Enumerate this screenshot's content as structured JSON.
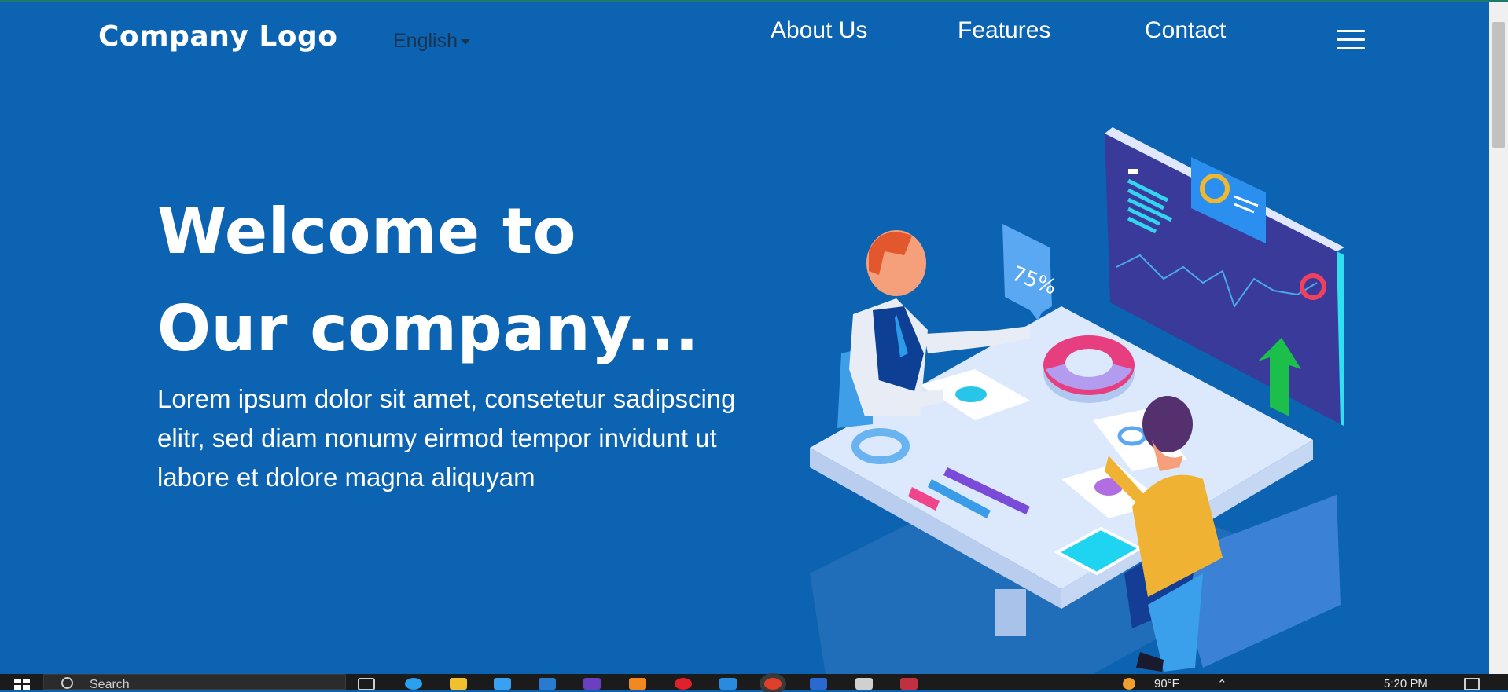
{
  "header": {
    "logo": "Company Logo",
    "language": "English",
    "nav": [
      "About Us",
      "Features",
      "Contact"
    ]
  },
  "hero": {
    "title_line1": "Welcome to",
    "title_line2": "Our company...",
    "description": "Lorem ipsum dolor sit amet, consetetur sadipscing elitr, sed diam nonumy eirmod tempor invidunt ut labore et dolore magna aliquyam"
  },
  "illustration": {
    "percent_label": "75%"
  },
  "taskbar": {
    "search_placeholder": "Search",
    "temperature": "90°F",
    "time": "5:20 PM"
  },
  "colors": {
    "background": "#0b63b1",
    "text": "#ffffff"
  }
}
